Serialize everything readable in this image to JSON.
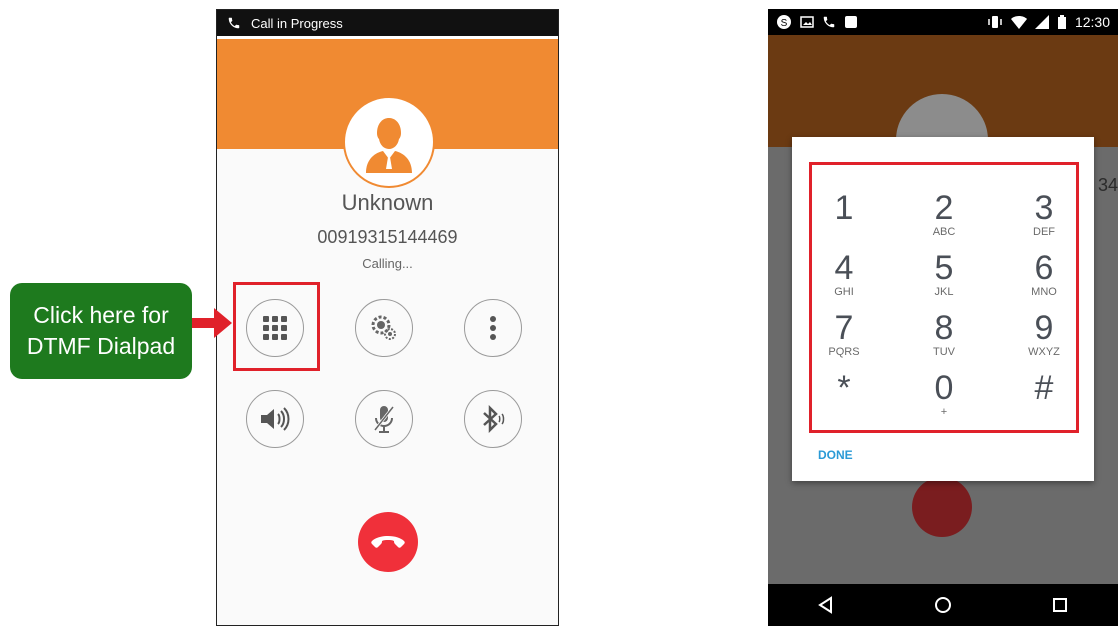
{
  "left_phone": {
    "status_title": "Call in Progress",
    "caller_name": "Unknown",
    "caller_number": "00919315144469",
    "call_status": "Calling...",
    "controls": [
      {
        "name": "dialpad-button",
        "icon": "dialpad-grid-icon"
      },
      {
        "name": "call-settings-button",
        "icon": "gear-icon"
      },
      {
        "name": "more-options-button",
        "icon": "more-vertical-icon"
      },
      {
        "name": "speaker-button",
        "icon": "speaker-icon"
      },
      {
        "name": "mute-button",
        "icon": "mic-muted-icon"
      },
      {
        "name": "bluetooth-button",
        "icon": "bluetooth-icon"
      }
    ],
    "hangup_icon": "hangup-phone-icon",
    "colors": {
      "accent": "#f08a32",
      "hangup": "#f0303a",
      "highlight": "#e0212a"
    }
  },
  "callout": {
    "line1": "Click here for",
    "line2": "DTMF Dialpad",
    "color": "#1e7a1e"
  },
  "right_phone": {
    "status_time": "12:30",
    "edge_text": "34",
    "keys": [
      {
        "digit": "1",
        "letters": ""
      },
      {
        "digit": "2",
        "letters": "ABC"
      },
      {
        "digit": "3",
        "letters": "DEF"
      },
      {
        "digit": "4",
        "letters": "GHI"
      },
      {
        "digit": "5",
        "letters": "JKL"
      },
      {
        "digit": "6",
        "letters": "MNO"
      },
      {
        "digit": "7",
        "letters": "PQRS"
      },
      {
        "digit": "8",
        "letters": "TUV"
      },
      {
        "digit": "9",
        "letters": "WXYZ"
      },
      {
        "digit": "*",
        "letters": ""
      },
      {
        "digit": "0",
        "letters": "+"
      },
      {
        "digit": "#",
        "letters": ""
      }
    ],
    "done_label": "DONE",
    "nav": [
      "back-icon",
      "home-icon",
      "recents-icon"
    ]
  }
}
